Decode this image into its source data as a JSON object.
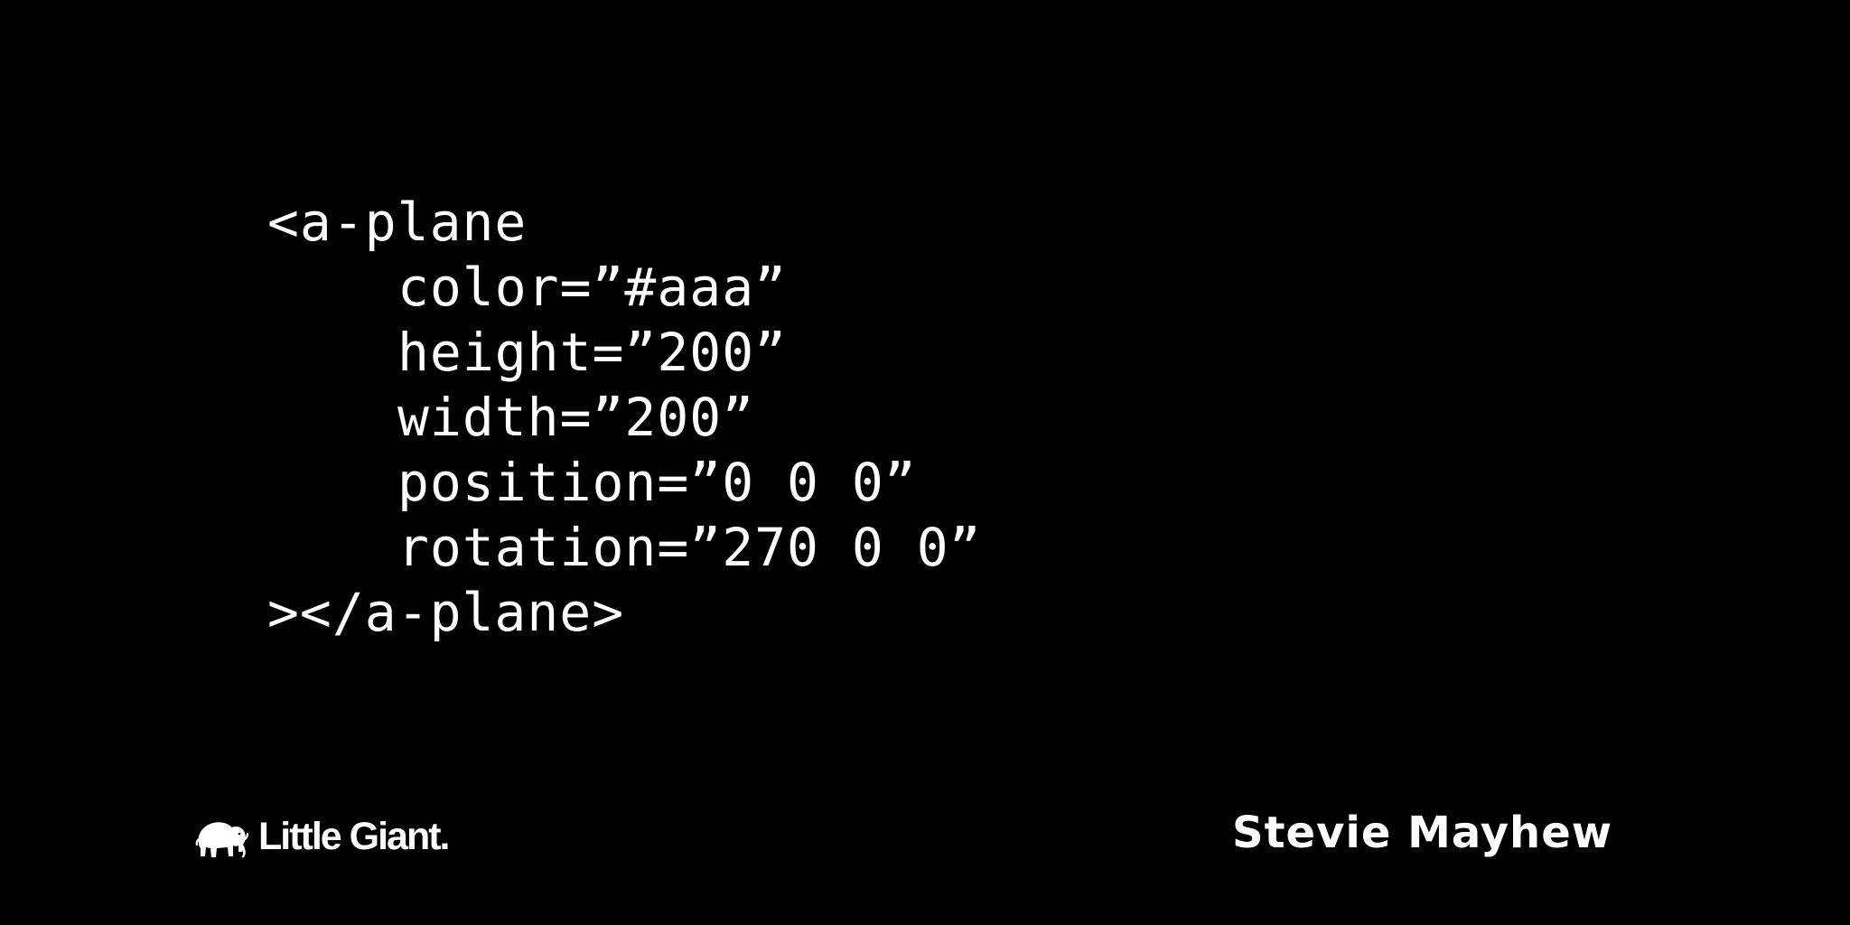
{
  "slide": {
    "background_color": "#000000",
    "text_color": "#ffffff"
  },
  "code": {
    "lines": [
      {
        "text": "<a-plane"
      },
      {
        "text": "color=”#aaa”"
      },
      {
        "text": "height=”200”"
      },
      {
        "text": "width=”200”"
      },
      {
        "text": "position=”0 0 0”"
      },
      {
        "text": "rotation=”270 0 0”"
      },
      {
        "text": "></a-plane>"
      }
    ]
  },
  "footer": {
    "logo_icon": "mammoth-icon",
    "brand_name": "Little Giant.",
    "speaker_name": "Stevie Mayhew"
  }
}
